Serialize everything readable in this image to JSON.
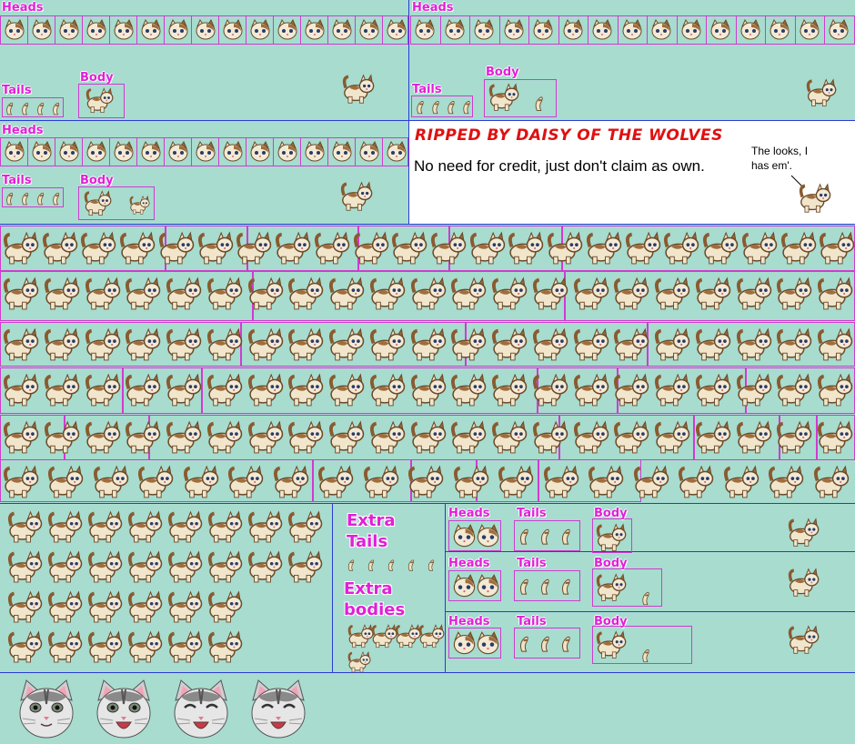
{
  "labels": {
    "heads": "Heads",
    "tails": "Tails",
    "body": "Body",
    "extra_tails_1": "Extra",
    "extra_tails_2": "Tails",
    "extra_bodies_1": "Extra",
    "extra_bodies_2": "bodies"
  },
  "credit": {
    "title": "RIPPED BY DAISY OF THE WOLVES",
    "note": "No need for credit, just don't claim as own.",
    "bubble": "The looks, I has em'."
  },
  "colors": {
    "background": "#a7dccf",
    "divider": "#2a3bd6",
    "frame": "#d03bd0",
    "label": "#e21fd8",
    "credit_title": "#e01010"
  },
  "icons": {
    "sprite": "cat-sprite-icon",
    "face": "cat-face-icon"
  }
}
